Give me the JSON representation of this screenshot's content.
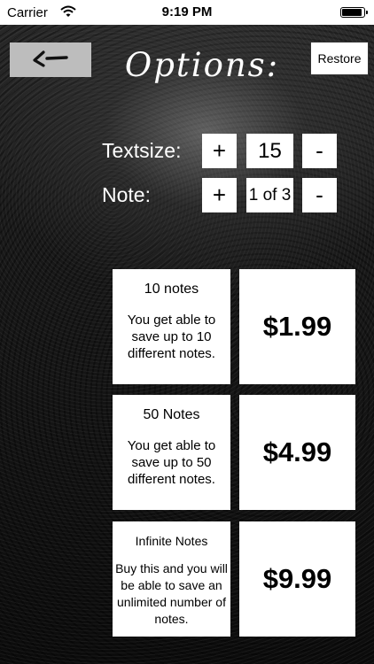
{
  "status_bar": {
    "carrier": "Carrier",
    "time": "9:19 PM",
    "wifi_icon": "wifi-icon",
    "battery_icon": "battery-icon"
  },
  "header": {
    "back_icon": "back-arrow-icon",
    "title": "Options:",
    "restore_label": "Restore"
  },
  "options": {
    "textsize": {
      "label": "Textsize:",
      "plus_label": "+",
      "value": "15",
      "minus_label": "-"
    },
    "note": {
      "label": "Note:",
      "plus_label": "+",
      "value": "1 of 3",
      "minus_label": "-"
    }
  },
  "products": [
    {
      "title": "10 notes",
      "description": "You get able to save up to 10 different notes.",
      "price": "$1.99"
    },
    {
      "title": "50 Notes",
      "description": "You get able to save up to 50 different notes.",
      "price": "$4.99"
    },
    {
      "title": "Infinite Notes",
      "description": "Buy this and you will be able to save an unlimited number of notes.",
      "price": "$9.99"
    }
  ],
  "colors": {
    "card_background": "#ffffff",
    "back_button_background": "#bdbdbd",
    "text_on_dark": "#ffffff"
  }
}
